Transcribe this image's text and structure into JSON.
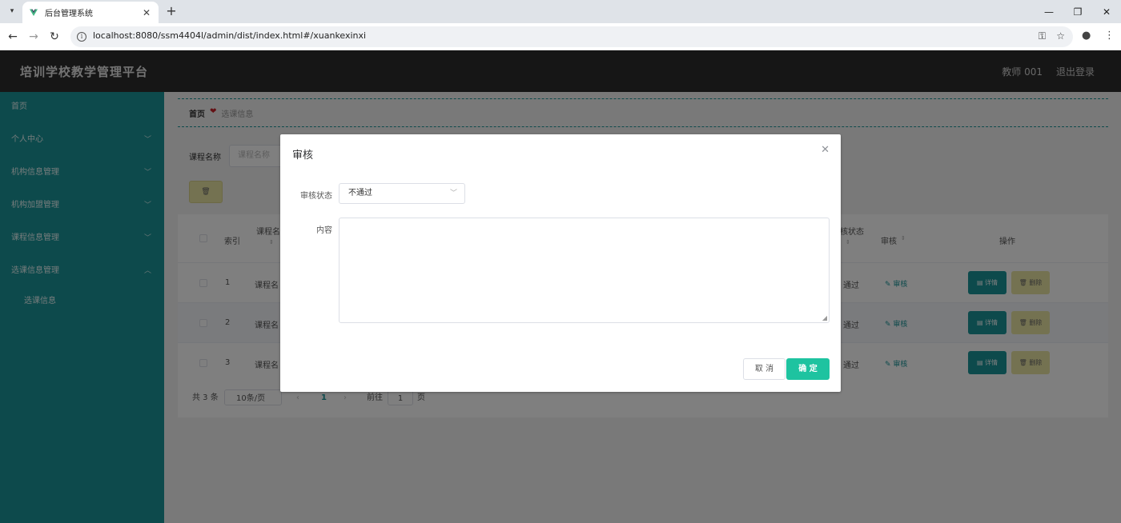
{
  "browser": {
    "tab_title": "后台管理系统",
    "tab_close": "✕",
    "new_tab": "+",
    "url": "localhost:8080/ssm4404l/admin/dist/index.html#/xuankexinxi"
  },
  "header": {
    "title": "培训学校教学管理平台",
    "user": "教师 001",
    "logout": "退出登录"
  },
  "sidebar": {
    "items": [
      {
        "label": "首页"
      },
      {
        "label": "个人中心"
      },
      {
        "label": "机构信息管理"
      },
      {
        "label": "机构加盟管理"
      },
      {
        "label": "课程信息管理"
      },
      {
        "label": "选课信息管理"
      },
      {
        "label": "选课信息"
      }
    ]
  },
  "breadcrumb": {
    "home": "首页",
    "heart": "❤",
    "current": "选课信息"
  },
  "search": {
    "label": "课程名称",
    "placeholder": "课程名称"
  },
  "table": {
    "headers": {
      "index": "索引",
      "course": "课程名",
      "audit_status": "核状态",
      "audit": "审核",
      "action": "操作"
    },
    "rows": [
      {
        "index": "1",
        "course": "课程名",
        "status": "通过",
        "audit": "审核",
        "detail": "详情",
        "delete": "删除"
      },
      {
        "index": "2",
        "course": "课程名",
        "status": "通过",
        "audit": "审核",
        "detail": "详情",
        "delete": "删除"
      },
      {
        "index": "3",
        "course": "课程名",
        "status": "通过",
        "audit": "审核",
        "detail": "详情",
        "delete": "删除"
      }
    ]
  },
  "pagination": {
    "total": "共 3 条",
    "page_size": "10条/页",
    "current_page": "1",
    "goto_label": "前往",
    "goto_value": "1",
    "page_unit": "页"
  },
  "dialog": {
    "title": "审核",
    "status_label": "审核状态",
    "status_value": "不通过",
    "content_label": "内容",
    "cancel": "取 消",
    "confirm": "确 定"
  },
  "colors": {
    "teal": "#1a9599",
    "header_dark": "#2d2d2d",
    "confirm_green": "#1ec3a0",
    "delete_yellow": "#e8e4a3"
  }
}
